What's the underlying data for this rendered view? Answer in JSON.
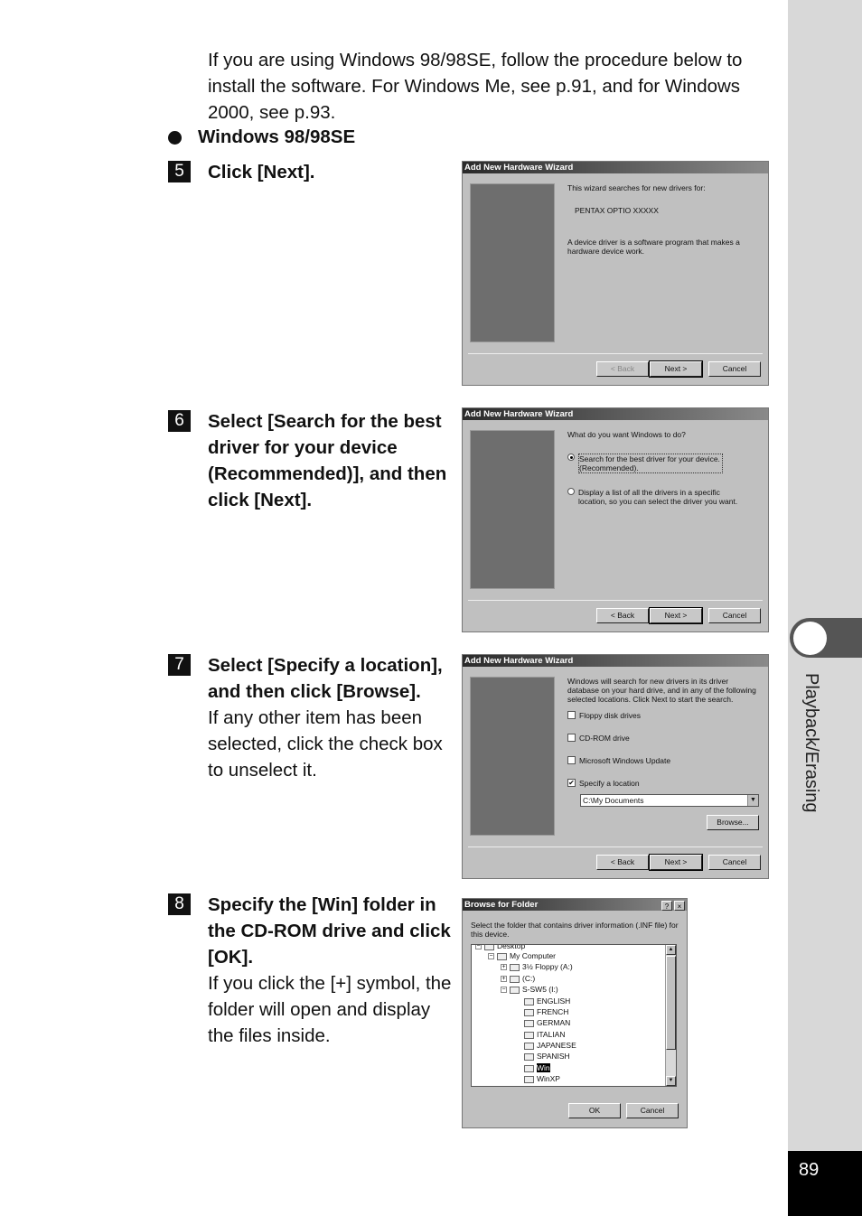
{
  "intro": "If you are using Windows 98/98SE, follow the procedure below to install the software. For Windows Me, see p.91, and for Windows 2000, see p.93.",
  "section_heading": "Windows 98/98SE",
  "steps": [
    {
      "num": "5",
      "title": "Click [Next].",
      "note": ""
    },
    {
      "num": "6",
      "title": "Select [Search for the best driver for your device (Recommended)], and then click [Next].",
      "note": ""
    },
    {
      "num": "7",
      "title": "Select [Specify a location], and then click [Browse].",
      "note": "If any other item has been selected, click the check box to unselect it."
    },
    {
      "num": "8",
      "title": "Specify the [Win] folder in the CD-ROM drive and click [OK].",
      "note": "If you click the [+] symbol, the folder will open and display the files inside."
    }
  ],
  "sidebar": {
    "section_label": "Playback/Erasing",
    "page_number": "89"
  },
  "dialog1": {
    "title": "Add New Hardware Wizard",
    "line1": "This wizard searches for new drivers for:",
    "device": "PENTAX OPTIO XXXXX",
    "line2": "A device driver is a software program that makes a hardware device work.",
    "back": "< Back",
    "next": "Next >",
    "cancel": "Cancel"
  },
  "dialog2": {
    "title": "Add New Hardware Wizard",
    "question": "What do you want Windows to do?",
    "option1": "Search for the best driver for your device. (Recommended).",
    "option2": "Display a list of all the drivers in a specific location, so you can select the driver you want.",
    "back": "< Back",
    "next": "Next >",
    "cancel": "Cancel"
  },
  "dialog3": {
    "title": "Add New Hardware Wizard",
    "text": "Windows will search for new drivers in its driver database on your hard drive, and in any of the following selected locations. Click Next to start the search.",
    "checks": [
      {
        "label": "Floppy disk drives",
        "checked": false
      },
      {
        "label": "CD-ROM drive",
        "checked": false
      },
      {
        "label": "Microsoft Windows Update",
        "checked": false
      },
      {
        "label": "Specify a location",
        "checked": true
      }
    ],
    "location_value": "C:\\My Documents",
    "browse": "Browse...",
    "back": "< Back",
    "next": "Next >",
    "cancel": "Cancel"
  },
  "dialog4": {
    "title": "Browse for Folder",
    "help_btn": "?",
    "close_btn": "×",
    "prompt": "Select the folder that contains driver information (.INF file) for this device.",
    "tree": [
      "Desktop",
      "My Computer",
      "3½ Floppy (A:)",
      "(C:)",
      "S-SW5 (I:)",
      "ENGLISH",
      "FRENCH",
      "GERMAN",
      "ITALIAN",
      "JAPANESE",
      "SPANISH",
      "Win",
      "WinXP"
    ],
    "selected": "Win",
    "ok": "OK",
    "cancel": "Cancel"
  }
}
